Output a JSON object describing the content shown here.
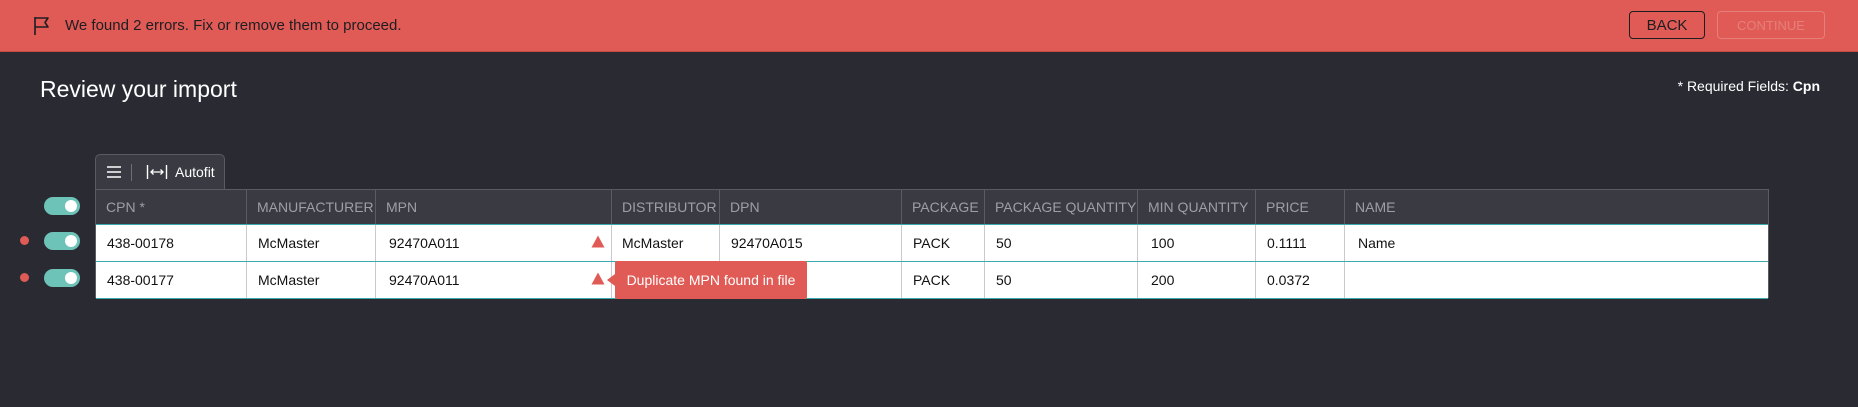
{
  "banner": {
    "message": "We found 2 errors. Fix or remove them to proceed.",
    "back_label": "BACK",
    "continue_label": "CONTINUE",
    "color": "#e05b56"
  },
  "page": {
    "title": "Review your import",
    "required_prefix": "* Required Fields:",
    "required_fields": "Cpn"
  },
  "toolbar": {
    "autofit_label": "Autofit"
  },
  "table": {
    "columns": [
      "CPN *",
      "MANUFACTURER",
      "MPN",
      "DISTRIBUTOR",
      "DPN",
      "PACKAGE",
      "PACKAGE QUANTITY",
      "MIN QUANTITY",
      "PRICE",
      "NAME"
    ],
    "rows": [
      {
        "enabled": true,
        "has_error": true,
        "cells": [
          "438-00178",
          "McMaster",
          "92470A011",
          "McMaster",
          "92470A015",
          "PACK",
          "50",
          "100",
          "0.1111",
          "Name"
        ]
      },
      {
        "enabled": true,
        "has_error": true,
        "cells": [
          "438-00177",
          "McMaster",
          "92470A011",
          "",
          "",
          "PACK",
          "50",
          "200",
          "0.0372",
          ""
        ]
      }
    ]
  },
  "header_toggle": {
    "enabled": true
  },
  "tooltip": {
    "text": "Duplicate MPN found in file"
  },
  "colors": {
    "background": "#2a2a33",
    "toggle_on": "#6ec3b9",
    "error": "#e05b56",
    "row_border": "#3ca9ab"
  }
}
